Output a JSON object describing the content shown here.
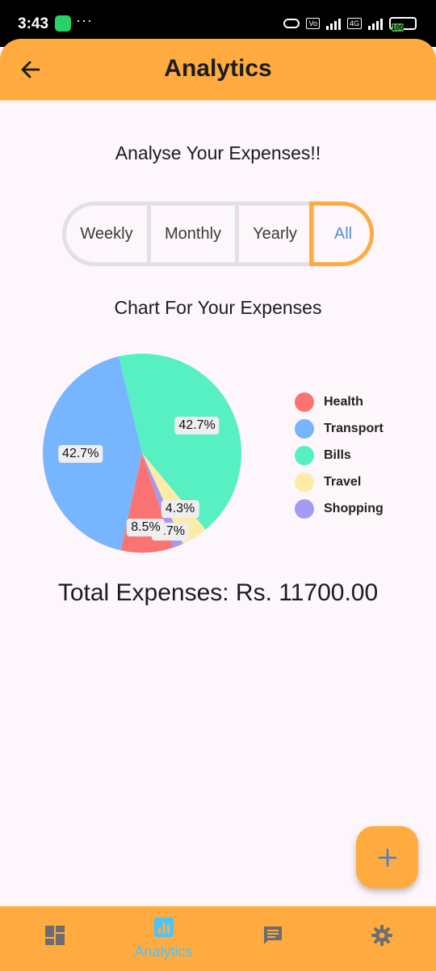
{
  "status_bar": {
    "time": "3:43",
    "dots": "···",
    "network": "4G",
    "battery": "100"
  },
  "app_bar": {
    "title": "Analytics",
    "back_icon": "arrow-left-icon"
  },
  "heading": "Analyse Your Expenses!!",
  "period_tabs": [
    {
      "label": "Weekly",
      "selected": false
    },
    {
      "label": "Monthly",
      "selected": false
    },
    {
      "label": "Yearly",
      "selected": false
    },
    {
      "label": "All",
      "selected": true
    }
  ],
  "chart_title": "Chart For Your Expenses",
  "chart_data": {
    "type": "pie",
    "title": "Chart For Your Expenses",
    "slices": [
      {
        "label": "Bills",
        "value": 42.7,
        "display": "42.7%",
        "color": "#56f0c2"
      },
      {
        "label": "Travel",
        "value": 4.3,
        "display": "4.3%",
        "color": "#fdeba8"
      },
      {
        "label": "Shopping",
        "value": 1.7,
        "display": "1.7%",
        "color": "#a49bf5"
      },
      {
        "label": "Health",
        "value": 8.5,
        "display": "8.5%",
        "color": "#fb7373"
      },
      {
        "label": "Transport",
        "value": 42.7,
        "display": "42.7%",
        "color": "#77b6fe"
      }
    ],
    "legend": [
      {
        "label": "Health",
        "color": "#fb7373"
      },
      {
        "label": "Transport",
        "color": "#77b6fe"
      },
      {
        "label": "Bills",
        "color": "#56f0c2"
      },
      {
        "label": "Travel",
        "color": "#fdeba8"
      },
      {
        "label": "Shopping",
        "color": "#a49bf5"
      }
    ],
    "legend_position": "right"
  },
  "total": "Total Expenses: Rs. 11700.00",
  "fab": {
    "icon": "plus-icon"
  },
  "bottom_nav": [
    {
      "icon": "dashboard-icon",
      "label": "",
      "active": false
    },
    {
      "icon": "bar-chart-icon",
      "label": "Analytics",
      "active": true
    },
    {
      "icon": "message-icon",
      "label": "",
      "active": false
    },
    {
      "icon": "gear-icon",
      "label": "",
      "active": false
    }
  ],
  "colors": {
    "accent": "#ffab40",
    "background": "#fdf6fb",
    "active_nav": "#4fc3f7",
    "selected_tab_text": "#5a8bd6"
  }
}
